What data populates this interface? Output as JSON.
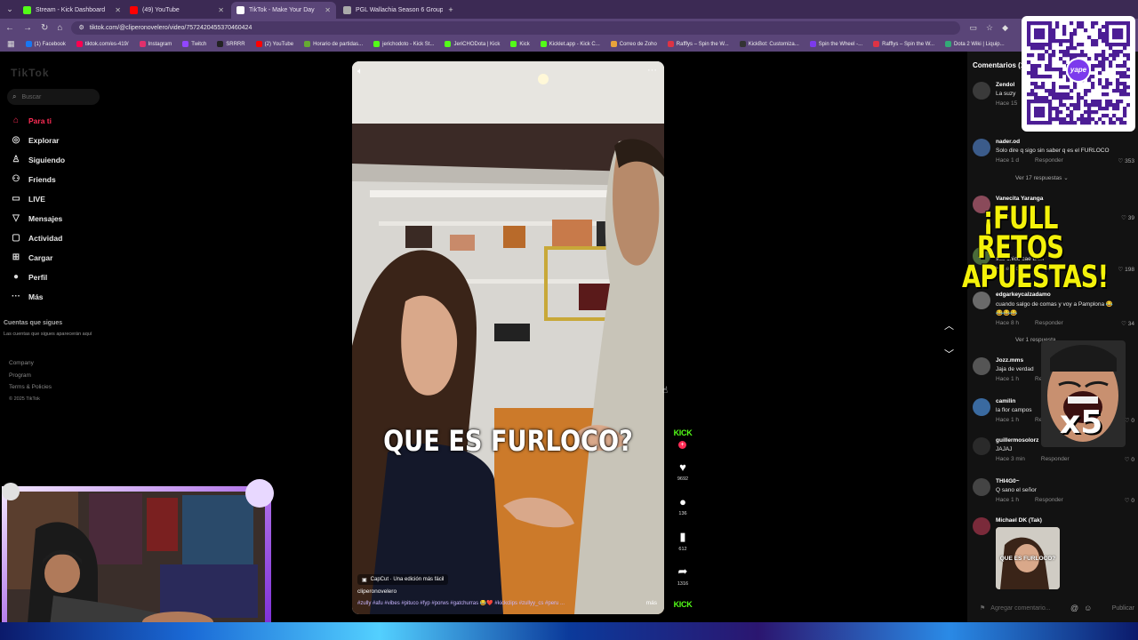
{
  "browser": {
    "tabs": [
      {
        "label": "Stream - Kick Dashboard",
        "fav": "#53fc18",
        "active": false
      },
      {
        "label": "(49) YouTube",
        "fav": "#ff0000",
        "active": false
      },
      {
        "label": "TikTok - Make Your Day",
        "fav": "#ffffff",
        "active": true
      },
      {
        "label": "PGL Wallachia Season 6 Group",
        "fav": "#aaaaaa",
        "active": false
      }
    ],
    "url": "tiktok.com/@cliperonovelero/video/7572420455370460424",
    "bookmarks": [
      "(1) Facebook",
      "tiktok.com/es-419/",
      "Instagram",
      "Twitch",
      "SRRRR",
      "(2) YouTube",
      "Horario de partidas...",
      "jerichodoto - Kick St...",
      "JeriCHODota | Kick",
      "Kick",
      "Kicklet.app - Kick C...",
      "Correo de Zoho",
      "Rafflys – Spin the W...",
      "KickBot: Customiza...",
      "Spin the Wheel -...",
      "Rafflys – Spin the W...",
      "Dota 2 Wiki | Liquip..."
    ]
  },
  "sidebar": {
    "logo": "TikTok",
    "search_placeholder": "Buscar",
    "items": [
      {
        "label": "Para ti",
        "icon": "home-icon",
        "glyph": "⌂",
        "active": true
      },
      {
        "label": "Explorar",
        "icon": "compass-icon",
        "glyph": "◎",
        "active": false
      },
      {
        "label": "Siguiendo",
        "icon": "following-icon",
        "glyph": "♙",
        "active": false
      },
      {
        "label": "Friends",
        "icon": "friends-icon",
        "glyph": "⚇",
        "active": false
      },
      {
        "label": "LIVE",
        "icon": "live-icon",
        "glyph": "▭",
        "active": false
      },
      {
        "label": "Mensajes",
        "icon": "messages-icon",
        "glyph": "▽",
        "active": false
      },
      {
        "label": "Actividad",
        "icon": "activity-icon",
        "glyph": "▢",
        "active": false
      },
      {
        "label": "Cargar",
        "icon": "upload-icon",
        "glyph": "⊞",
        "active": false
      },
      {
        "label": "Perfil",
        "icon": "profile-icon",
        "glyph": "●",
        "active": false
      },
      {
        "label": "Más",
        "icon": "more-icon",
        "glyph": "···",
        "active": false
      }
    ],
    "following_heading": "Cuentas que sigues",
    "following_text": "Las cuentas que sigues aparecerán aquí",
    "footer": [
      "Company",
      "Program",
      "Terms & Policies",
      "© 2025 TikTok"
    ]
  },
  "video": {
    "caption": "QUE ES FURLOCO?",
    "capcut": "CapCut · Una edición más fácil",
    "author": "cliperonovelero",
    "hashtags": "#zully #afu #vibes #pituco #fyp #porws #gatchurras 😂❤️ #kickclips #zullyy_cs #peru ...",
    "more": "más"
  },
  "actions": {
    "kick": "KICK",
    "likes": "9692",
    "comments": "136",
    "saves": "612",
    "shares": "1316"
  },
  "comments_panel": {
    "title": "Comentarios (1",
    "items": [
      {
        "user": "Zendol",
        "text": "La suzy",
        "meta": "Hace 15",
        "reply": "",
        "likes": "",
        "avatar": "#3a3a3a"
      },
      {
        "user": "nader.od",
        "text": "Solo dire q sigo sin saber q es el FURLOCO",
        "meta": "Hace 1 d",
        "reply": "Responder",
        "likes": "♡ 353",
        "replies": "Ver 17 respuestas ⌄",
        "avatar": "#3b5b8a"
      },
      {
        "user": "Vanecita Yaranga",
        "text": "",
        "meta": "Hace",
        "reply": "",
        "likes": "♡ 39",
        "avatar": "#8a4a5a"
      },
      {
        "user": "",
        "text": "ese chico cae bien",
        "meta": "Hace 1 d",
        "reply": "Responder",
        "likes": "♡ 198",
        "avatar": "#4a6a3a"
      },
      {
        "user": "edgarkeycalzadamo",
        "text": "cuando salgo de comas y voy a Pamplona 😂",
        "text2": "😂😂😂",
        "meta": "Hace 8 h",
        "reply": "Responder",
        "likes": "♡ 34",
        "replies": "Ver 1 respuesta",
        "avatar": "#6a6a6a"
      },
      {
        "user": "Jozz.mms",
        "text": "Jaja de verdad",
        "meta": "Hace 1 h",
        "reply": "Resp",
        "likes": "",
        "avatar": "#555555"
      },
      {
        "user": "camilin",
        "text": "la flor campos",
        "meta": "Hace 1 h",
        "reply": "Resp",
        "likes": "♡ 0",
        "avatar": "#3a6aa0"
      },
      {
        "user": "guillermosolorz",
        "text": "JAJAJ",
        "meta": "Hace 3 min",
        "reply": "Responder",
        "likes": "♡ 0",
        "avatar": "#2a2a2a"
      },
      {
        "user": "THI4G0~",
        "text": "Q sano el señor",
        "meta": "Hace 1 h",
        "reply": "Responder",
        "likes": "♡ 0",
        "avatar": "#444444"
      },
      {
        "user": "Michael DK (Tak)",
        "text": "",
        "meta": "",
        "reply": "",
        "likes": "",
        "avatar": "#7a2a3a"
      }
    ],
    "thumb_caption": "QUE ES FURLOCO?",
    "input_placeholder": "Agregar comentario...",
    "publish": "Publicar"
  },
  "overlays": {
    "qr_logo": "yape",
    "retos": "¡FULL RETOS APUESTAS!",
    "x5": "x5"
  }
}
